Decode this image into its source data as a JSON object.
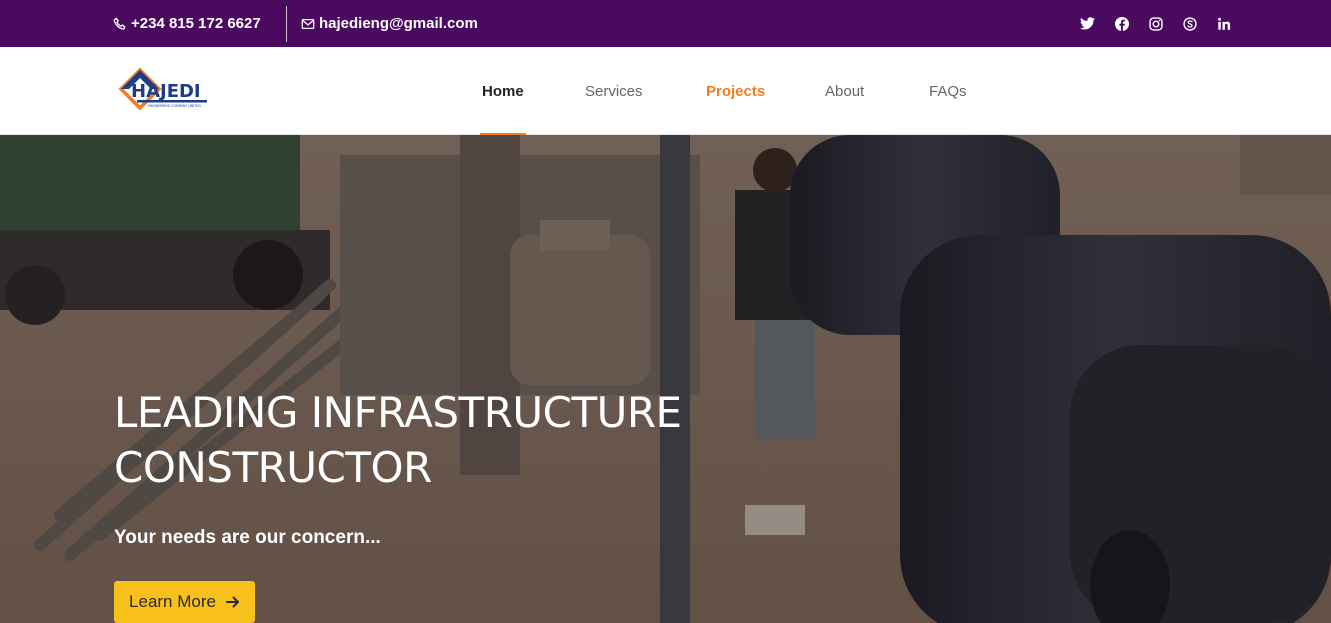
{
  "topbar": {
    "phone": "+234 815 172 6627",
    "email": "hajedieng@gmail.com",
    "phone_icon": "phone-icon",
    "email_icon": "envelope-icon",
    "social": [
      "twitter-icon",
      "facebook-icon",
      "instagram-icon",
      "skype-icon",
      "linkedin-icon"
    ],
    "background_color": "#4a0a5f"
  },
  "logo": {
    "text": "HAJEDI",
    "tagline": "ENGINEERING COMPANY LIMITED",
    "colors": [
      "#1f3c88",
      "#ef7d22"
    ]
  },
  "nav": {
    "items": [
      {
        "label": "Home",
        "state": "active"
      },
      {
        "label": "Services",
        "state": "normal"
      },
      {
        "label": "Projects",
        "state": "highlighted"
      },
      {
        "label": "About",
        "state": "normal"
      },
      {
        "label": "FAQs",
        "state": "normal"
      }
    ],
    "accent_color": "#ef7d22"
  },
  "hero": {
    "title_line1": "LEADING INFRASTRUCTURE",
    "title_line2": "CONSTRUCTOR",
    "subtitle": "Your needs are our concern...",
    "button_label": "Learn More",
    "button_icon": "arrow-right-icon",
    "button_color": "#f7c01b"
  }
}
